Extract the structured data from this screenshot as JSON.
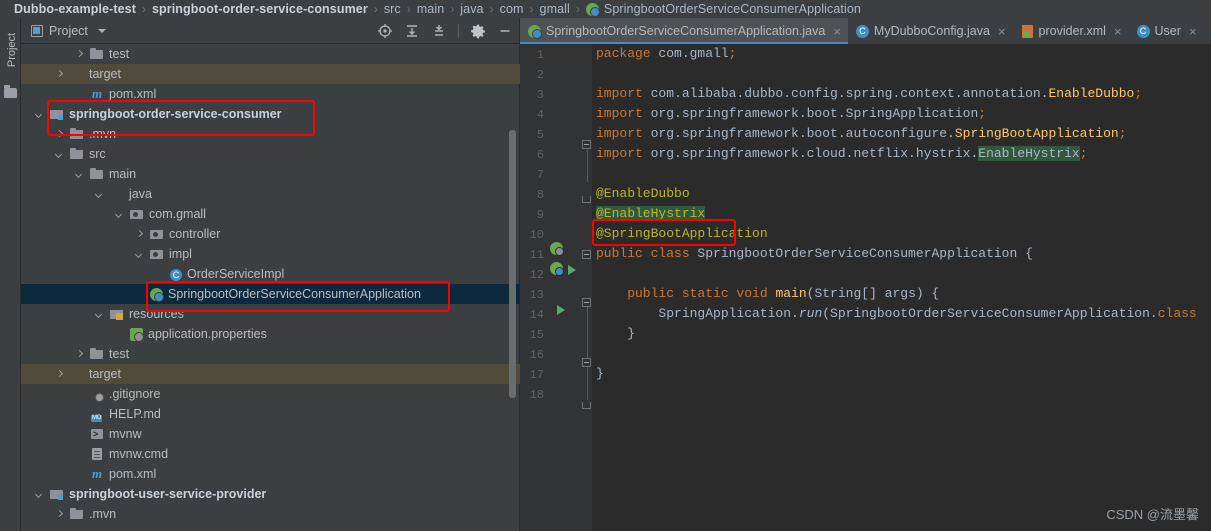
{
  "breadcrumb": {
    "items": [
      {
        "label": "Dubbo-example-test",
        "bold": true,
        "icon": null
      },
      {
        "label": "springboot-order-service-consumer",
        "bold": true,
        "icon": null
      },
      {
        "label": "src",
        "bold": false,
        "icon": null
      },
      {
        "label": "main",
        "bold": false,
        "icon": null
      },
      {
        "label": "java",
        "bold": false,
        "icon": null
      },
      {
        "label": "com",
        "bold": false,
        "icon": null
      },
      {
        "label": "gmall",
        "bold": false,
        "icon": null
      },
      {
        "label": "SpringbootOrderServiceConsumerApplication",
        "bold": false,
        "icon": "spring-boot-class-icon"
      }
    ],
    "separator": "›"
  },
  "tool_window_strip": {
    "label": "Project",
    "icon": "folder-icon"
  },
  "project_panel": {
    "title": "Project",
    "title_icon": "project-view-icon",
    "dropdown_icon": "chevron-down-icon",
    "toolbar_icons": [
      "locate-in-tree-icon",
      "expand-all-icon",
      "collapse-all-icon",
      "settings-gear-icon",
      "hide-panel-icon"
    ],
    "tree": [
      {
        "label": "test",
        "indent": 4,
        "arrow": "right",
        "icon": "folder",
        "state": "normal",
        "bold": false
      },
      {
        "label": "target",
        "indent": 3,
        "arrow": "right",
        "icon": "folder-orange",
        "state": "excluded",
        "bold": false
      },
      {
        "label": "pom.xml",
        "indent": 4,
        "arrow": "none",
        "icon": "maven",
        "state": "normal",
        "bold": false
      },
      {
        "label": "springboot-order-service-consumer",
        "indent": 2,
        "arrow": "down",
        "icon": "module",
        "state": "normal",
        "bold": true
      },
      {
        "label": ".mvn",
        "indent": 3,
        "arrow": "right",
        "icon": "folder",
        "state": "normal",
        "bold": false
      },
      {
        "label": "src",
        "indent": 3,
        "arrow": "down",
        "icon": "folder",
        "state": "normal",
        "bold": false
      },
      {
        "label": "main",
        "indent": 4,
        "arrow": "down",
        "icon": "folder",
        "state": "normal",
        "bold": false
      },
      {
        "label": "java",
        "indent": 5,
        "arrow": "down",
        "icon": "folder-blue",
        "state": "normal",
        "bold": false
      },
      {
        "label": "com.gmall",
        "indent": 6,
        "arrow": "down",
        "icon": "pkg",
        "state": "normal",
        "bold": false
      },
      {
        "label": "controller",
        "indent": 7,
        "arrow": "right",
        "icon": "pkg",
        "state": "normal",
        "bold": false
      },
      {
        "label": "impl",
        "indent": 7,
        "arrow": "down",
        "icon": "pkg",
        "state": "normal",
        "bold": false
      },
      {
        "label": "OrderServiceImpl",
        "indent": 8,
        "arrow": "none",
        "icon": "cls",
        "state": "normal",
        "bold": false
      },
      {
        "label": "SpringbootOrderServiceConsumerApplication",
        "indent": 7,
        "arrow": "none",
        "icon": "spring",
        "state": "selected",
        "bold": false
      },
      {
        "label": "resources",
        "indent": 5,
        "arrow": "down",
        "icon": "res",
        "state": "normal",
        "bold": false
      },
      {
        "label": "application.properties",
        "indent": 6,
        "arrow": "none",
        "icon": "springprops",
        "state": "normal",
        "bold": false
      },
      {
        "label": "test",
        "indent": 4,
        "arrow": "right",
        "icon": "folder",
        "state": "normal",
        "bold": false
      },
      {
        "label": "target",
        "indent": 3,
        "arrow": "right",
        "icon": "folder-orange",
        "state": "excluded",
        "bold": false
      },
      {
        "label": ".gitignore",
        "indent": 4,
        "arrow": "none",
        "icon": "gitignore",
        "state": "normal",
        "bold": false
      },
      {
        "label": "HELP.md",
        "indent": 4,
        "arrow": "none",
        "icon": "md",
        "state": "normal",
        "bold": false
      },
      {
        "label": "mvnw",
        "indent": 4,
        "arrow": "none",
        "icon": "sh",
        "state": "normal",
        "bold": false
      },
      {
        "label": "mvnw.cmd",
        "indent": 4,
        "arrow": "none",
        "icon": "file",
        "state": "normal",
        "bold": false
      },
      {
        "label": "pom.xml",
        "indent": 4,
        "arrow": "none",
        "icon": "maven",
        "state": "normal",
        "bold": false
      },
      {
        "label": "springboot-user-service-provider",
        "indent": 2,
        "arrow": "down",
        "icon": "module",
        "state": "normal",
        "bold": true
      },
      {
        "label": ".mvn",
        "indent": 3,
        "arrow": "right",
        "icon": "folder",
        "state": "normal",
        "bold": false
      }
    ]
  },
  "editor": {
    "tabs": [
      {
        "label": "SpringbootOrderServiceConsumerApplication.java",
        "icon": "spring-boot-class-icon",
        "active": true,
        "close": "×"
      },
      {
        "label": "MyDubboConfig.java",
        "icon": "java-class-icon",
        "active": false,
        "close": "×"
      },
      {
        "label": "provider.xml",
        "icon": "spring-xml-icon",
        "active": false,
        "close": "×"
      },
      {
        "label": "User",
        "icon": "java-class-icon",
        "active": false,
        "close": "×"
      }
    ],
    "line_numbers": [
      "1",
      "2",
      "3",
      "4",
      "5",
      "6",
      "7",
      "8",
      "9",
      "10",
      "11",
      "12",
      "13",
      "14",
      "15",
      "16",
      "17",
      "18"
    ],
    "code_lines": [
      {
        "n": 1,
        "tokens": [
          {
            "t": "package ",
            "c": "kw"
          },
          {
            "t": "com.gmall",
            "c": "plain"
          },
          {
            "t": ";",
            "c": "kw"
          }
        ]
      },
      {
        "n": 2,
        "tokens": []
      },
      {
        "n": 3,
        "tokens": [
          {
            "t": "import ",
            "c": "kw"
          },
          {
            "t": "com.alibaba.dubbo.config.spring.context.annotation.",
            "c": "plain"
          },
          {
            "t": "EnableDubbo",
            "c": "ident"
          },
          {
            "t": ";",
            "c": "kw"
          }
        ]
      },
      {
        "n": 4,
        "tokens": [
          {
            "t": "import ",
            "c": "kw"
          },
          {
            "t": "org.springframework.boot.",
            "c": "plain"
          },
          {
            "t": "SpringApplication",
            "c": "plain"
          },
          {
            "t": ";",
            "c": "kw"
          }
        ]
      },
      {
        "n": 5,
        "tokens": [
          {
            "t": "import ",
            "c": "kw"
          },
          {
            "t": "org.springframework.boot.autoconfigure.",
            "c": "plain"
          },
          {
            "t": "SpringBootApplication",
            "c": "ident"
          },
          {
            "t": ";",
            "c": "kw"
          }
        ]
      },
      {
        "n": 6,
        "tokens": [
          {
            "t": "import ",
            "c": "kw"
          },
          {
            "t": "org.springframework.cloud.netflix.hystrix.",
            "c": "plain"
          },
          {
            "t": "EnableHystrix",
            "c": "plain hl"
          },
          {
            "t": ";",
            "c": "kw"
          }
        ]
      },
      {
        "n": 7,
        "tokens": []
      },
      {
        "n": 8,
        "tokens": [
          {
            "t": "@EnableDubbo",
            "c": "ann"
          }
        ]
      },
      {
        "n": 9,
        "tokens": [
          {
            "t": "@EnableHystrix",
            "c": "ann hl"
          }
        ]
      },
      {
        "n": 10,
        "tokens": [
          {
            "t": "@SpringBootApplication",
            "c": "ann"
          }
        ]
      },
      {
        "n": 11,
        "tokens": [
          {
            "t": "public class ",
            "c": "kw"
          },
          {
            "t": "SpringbootOrderServiceConsumerApplication ",
            "c": "plain"
          },
          {
            "t": "{",
            "c": "plain"
          }
        ]
      },
      {
        "n": 12,
        "tokens": []
      },
      {
        "n": 13,
        "tokens": [
          {
            "t": "    public static void ",
            "c": "kw"
          },
          {
            "t": "main",
            "c": "ident"
          },
          {
            "t": "(String[] args) {",
            "c": "plain"
          }
        ]
      },
      {
        "n": 14,
        "tokens": [
          {
            "t": "        SpringApplication.",
            "c": "plain"
          },
          {
            "t": "run",
            "c": "plain italic"
          },
          {
            "t": "(SpringbootOrderServiceConsumerApplication.",
            "c": "plain"
          },
          {
            "t": "class",
            "c": "kw"
          }
        ]
      },
      {
        "n": 15,
        "tokens": [
          {
            "t": "    }",
            "c": "plain"
          }
        ]
      },
      {
        "n": 16,
        "tokens": []
      },
      {
        "n": 17,
        "tokens": [
          {
            "t": "}",
            "c": "plain"
          }
        ]
      },
      {
        "n": 18,
        "tokens": []
      }
    ],
    "gutter_markers": [
      {
        "line": 10,
        "icon": "spring-bean-icon"
      },
      {
        "line": 11,
        "icon": "spring-boot-class-icon"
      },
      {
        "line": 11,
        "icon": "run-arrow-icon"
      },
      {
        "line": 13,
        "icon": "run-arrow-icon"
      }
    ]
  },
  "annotations": {
    "red_boxes": [
      {
        "name": "module-highlight",
        "target": "springboot-order-service-consumer"
      },
      {
        "name": "application-class-highlight",
        "target": "SpringbootOrderServiceConsumerApplication"
      },
      {
        "name": "enable-hystrix-annotation-highlight",
        "target": "@EnableHystrix"
      }
    ],
    "accent_color": "#ff0000"
  },
  "watermark": {
    "text": "CSDN @流墨馨"
  }
}
